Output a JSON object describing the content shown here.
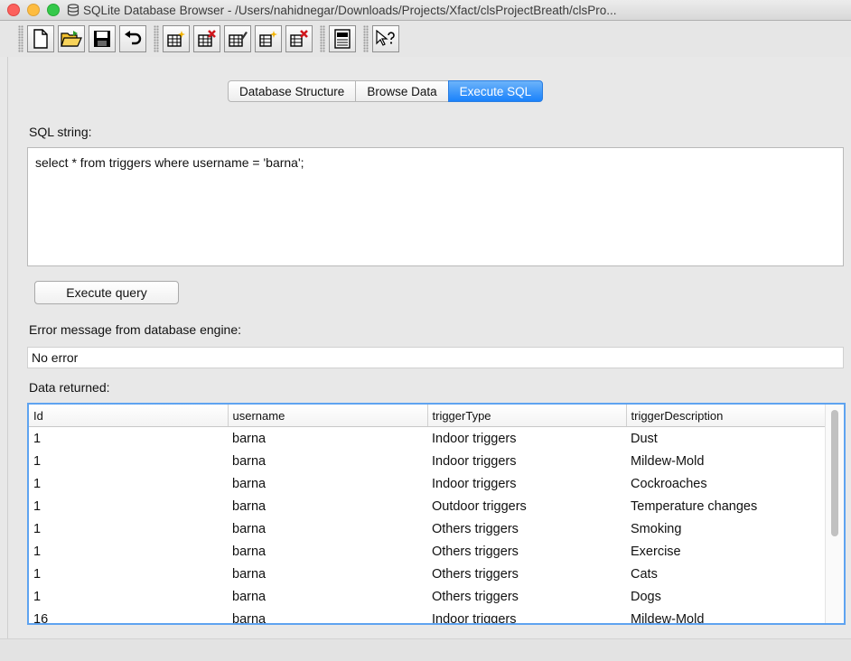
{
  "window": {
    "title": "SQLite Database Browser - /Users/nahidnegar/Downloads/Projects/Xfact/clsProjectBreath/clsPro..."
  },
  "toolbar": {
    "buttons": [
      {
        "name": "new-database-icon"
      },
      {
        "name": "open-database-icon"
      },
      {
        "name": "save-database-icon"
      },
      {
        "name": "undo-icon"
      },
      {
        "name": "create-table-icon"
      },
      {
        "name": "delete-table-icon"
      },
      {
        "name": "modify-table-icon"
      },
      {
        "name": "create-index-icon"
      },
      {
        "name": "delete-index-icon"
      },
      {
        "name": "sql-log-icon"
      },
      {
        "name": "whats-this-icon"
      }
    ]
  },
  "tabs": [
    {
      "label": "Database Structure",
      "active": false
    },
    {
      "label": "Browse Data",
      "active": false
    },
    {
      "label": "Execute SQL",
      "active": true
    }
  ],
  "sql": {
    "label": "SQL string:",
    "value": "select *  from triggers where username = 'barna';"
  },
  "execute": {
    "label": "Execute query"
  },
  "error": {
    "label": "Error message from database engine:",
    "value": "No error"
  },
  "results": {
    "label": "Data returned:",
    "columns": [
      "Id",
      "username",
      "triggerType",
      "triggerDescription"
    ],
    "rows": [
      [
        "1",
        "barna",
        "Indoor triggers",
        "Dust"
      ],
      [
        "1",
        "barna",
        "Indoor triggers",
        "Mildew-Mold"
      ],
      [
        "1",
        "barna",
        "Indoor triggers",
        "Cockroaches"
      ],
      [
        "1",
        "barna",
        "Outdoor triggers",
        "Temperature changes"
      ],
      [
        "1",
        "barna",
        "Others triggers",
        "Smoking"
      ],
      [
        "1",
        "barna",
        "Others triggers",
        "Exercise"
      ],
      [
        "1",
        "barna",
        "Others triggers",
        "Cats"
      ],
      [
        "1",
        "barna",
        "Others triggers",
        "Dogs"
      ],
      [
        "16",
        "barna",
        "Indoor triggers",
        "Mildew-Mold"
      ]
    ]
  },
  "colors": {
    "active_tab": "#1a82fb",
    "grid_focus": "#5ea3f0"
  }
}
